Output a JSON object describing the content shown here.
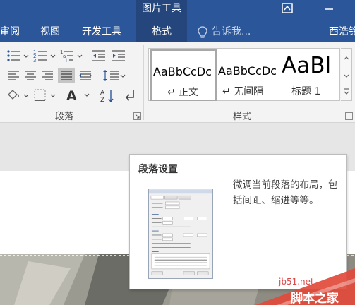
{
  "titlebar": {
    "context_group": "图片工具",
    "bg_color": "#2b579a"
  },
  "tabs": [
    {
      "label": "审阅"
    },
    {
      "label": "视图"
    },
    {
      "label": "开发工具"
    },
    {
      "label": "格式",
      "active": true
    }
  ],
  "tellme": {
    "placeholder": "告诉我..."
  },
  "account": {
    "name": "西浩铭"
  },
  "ribbon": {
    "paragraph_group": {
      "label": "段落"
    },
    "styles_group": {
      "label": "样式",
      "styles": [
        {
          "sample": "AaBbCcDc",
          "name": "↵ 正文"
        },
        {
          "sample": "AaBbCcDc",
          "name": "↵ 无间隔"
        },
        {
          "sample": "AaBl",
          "name": "标题 1"
        }
      ]
    }
  },
  "tooltip": {
    "title": "段落设置",
    "description": "微调当前段落的布局，包括间距、缩进等等。"
  },
  "watermark": {
    "site": "jb51.net",
    "name": "脚本之家"
  },
  "icons": [
    "restore-icon",
    "minimize-icon",
    "lightbulb-icon",
    "bullets-icon",
    "numbering-icon",
    "multilevel-list-icon",
    "decrease-indent-icon",
    "increase-indent-icon",
    "align-left-icon",
    "align-center-icon",
    "align-right-icon",
    "justify-icon",
    "distributed-icon",
    "line-spacing-icon",
    "shading-icon",
    "borders-icon",
    "font-size-icon",
    "sort-icon",
    "show-marks-icon",
    "dialog-launcher-icon"
  ]
}
